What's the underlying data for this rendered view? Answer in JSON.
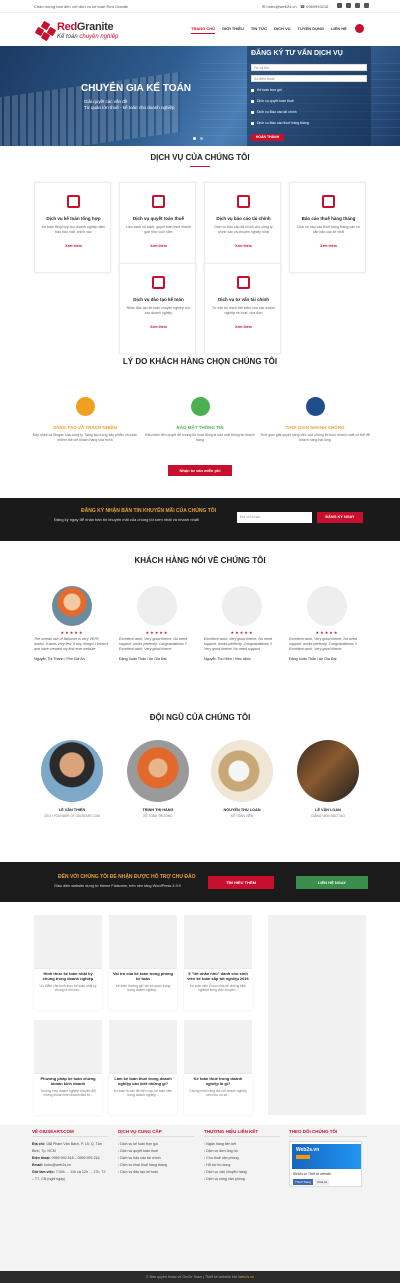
{
  "topbar": {
    "welcome": "Chào mừng bạn đến với dịch vụ kế toán Red Granite",
    "email": "hotro@web2s.vn",
    "phone": "0969993216"
  },
  "logo": {
    "brand_red": "Red",
    "brand_dark": "Granite",
    "sub1": "Kế toán",
    "sub2": "chuyên nghiệp"
  },
  "nav": [
    "Trang chủ",
    "Giới thiệu",
    "Tin tức",
    "Dịch vụ",
    "Tuyển dụng",
    "Liên hệ"
  ],
  "hero": {
    "title": "CHUYÊN GIA KẾ TOÁN",
    "line1": "Giải quyết các vấn đề",
    "line2": "Từ quản lớn thuế - kế toán cho doanh nghiệp",
    "form": {
      "title": "ĐĂNG KÝ TƯ VẤN DỊCH VỤ",
      "name_placeholder": "Họ và tên",
      "phone_placeholder": "Số điện thoại",
      "options": [
        "Kế toán trọn gói",
        "Dịch vụ quyết toán thuế",
        "Dịch vụ Báo cáo tài chính",
        "Dịch vụ Báo cáo thuế hàng tháng"
      ],
      "submit": "HOÀN THÀNH"
    }
  },
  "services": {
    "title": "DỊCH VỤ CỦA CHÚNG TÔI",
    "more": "Xem thêm",
    "items": [
      {
        "title": "Dịch vụ kế toán tổng hợp",
        "desc": "Kế toán tổng hợp cho doanh nghiệp đảm bảo báo mất, chính xác"
      },
      {
        "title": "Dịch vụ quyết toán thuế",
        "desc": "Làm sạch số sách, quyết toán thuế nhanh gọn như cuối năm"
      },
      {
        "title": "Dịch vụ báo cáo tài chính",
        "desc": "Dịch vụ báo cáo tài chính cho công ty chính xác và chuyên nghiệp nhất"
      },
      {
        "title": "Báo cáo thuế hàng tháng",
        "desc": "Dịch vụ báo cáo thuế hàng tháng cần có sẵn bảo các kê nhất"
      },
      {
        "title": "Dịch vụ đào tạo kế toán",
        "desc": "Nhận đào tạo kế toán chuyên nghiệp cho các doanh nghiệp"
      },
      {
        "title": "Dịch vụ tư vấn tài chính",
        "desc": "Tư vấn tài chính tiết kiệm cho các doanh nghiệp về thuế, hóa đơn"
      }
    ]
  },
  "reasons": {
    "title": "LÝ DO KHÁCH HÀNG CHỌN CHÚNG TÔI",
    "items": [
      {
        "title": "SÁNG TẠO VÀ TRÁCH NHIỆM",
        "desc": "Đây chính là Slogan của công ty. Sáng tạo trong sản phẩm và trách nhiệm đối với khách hàng của mình"
      },
      {
        "title": "BẢO MẬT THÔNG TIN",
        "desc": "Điều kiện tiên quyết để chúng tôi hoạt động là bảo mật thông tin khách hàng"
      },
      {
        "title": "THỜI GIAN NHANH CHÓNG",
        "desc": "Thời gian giải quyết công việc của chúng tôi luôn nhanh nhất có thể để khách hàng hài lòng"
      }
    ],
    "button": "Nhận tư vấn miễn phí"
  },
  "newsletter": {
    "title": "ĐĂNG KÝ NHẬN BẢN TIN KHUYẾN MÃI CỦA CHÚNG TÔI",
    "desc": "Đăng ký ngay để nhận bản tin khuyến mãi của chúng tôi sớm nhất và nhanh nhất!",
    "placeholder": "Địa chỉ email",
    "button": "ĐĂNG KÝ NGAY"
  },
  "testimonials": {
    "title": "KHÁCH HÀNG NÓI VỀ CHÚNG TÔI",
    "stars": "★★★★★",
    "items": [
      {
        "quote": "The overall use of flatsome is very VERY useful. It lacks very few, if any, things! I loved it and have created my first ever website",
        "name": "Nguyễn Thị Thanh",
        "role": "Phó Gia An"
      },
      {
        "quote": "Excellent work, Very good theme, No need support, works perfectly. Congratulations !! Excellent work, Very good theme",
        "name": "Đặng Xuân Thăn",
        "role": "An Gia Đạt"
      },
      {
        "quote": "Excellent work, Very good theme, No need support, works perfectly. Congratulations !! Very good theme! No need support",
        "name": "Nguyễn Thu Hiền",
        "role": "Vinc clinic"
      },
      {
        "quote": "Excellent work, Very good theme, No need support, works perfectly. Congratulations !! Excellent work, Very good theme",
        "name": "Đặng Xuân Thăn",
        "role": "An Gia Đạt"
      }
    ]
  },
  "team": {
    "title": "ĐỘI NGŨ CỦA CHÚNG TÔI",
    "items": [
      {
        "name": "LÊ VĂN THIỆN",
        "role": "CEO / FOUNDER OF GIUSEART.COM"
      },
      {
        "name": "TRỊNH THỊ HẰNG",
        "role": "KẾ TOÁN TRƯỞNG"
      },
      {
        "name": "NGUYỄN THU LOAN",
        "role": "KẾ TOÁN VIÊN"
      },
      {
        "name": "LÊ VĂN LOAN",
        "role": "GIẢNG VIÊN ĐÀO TẠO"
      }
    ]
  },
  "promo": {
    "title": "ĐẾN VỚI CHÚNG TÔI ĐỂ NHẬN ĐƯỢC HỖ TRỢ CHU ĐÁO",
    "desc": "Giao diện website dựng từ theme Flatsome, trên nền tảng WordPress 4.9.9",
    "more": "TÌM HIỂU THÊM",
    "contact": "LIÊN HỆ NGAY"
  },
  "posts": [
    {
      "title": "Hình thức kế toán nhật ký chung trong doanh nghiệp",
      "desc": "Ưu điểm của hình thức kế toán nhật ký chung là với các..."
    },
    {
      "title": "Vai trò của kế toán trong phòng kế toán",
      "desc": "Kế toán trưởng giữ vai trò quan trọng trong doanh nghiệp..."
    },
    {
      "title": "5 \"lời nhắn nhủ\" dành cho sinh viên kế toán sắp tốt nghiệp 2016",
      "desc": "Kế toán viên Zoom chia sẻ những kinh nghiệm công việc chuyên..."
    },
    {
      "title": "Phương pháp kế toán chứng khoán kinh doanh",
      "desc": "Trường hợp doanh nghiệp chuyển đổi chứng khoán kinh doanh đầu tư..."
    },
    {
      "title": "Làm kế toán thuế trong doanh nghiệp cần biết những gì?",
      "desc": "Kế toán là vấn đề hiện nay, kế toán viên trong doanh nghiệp..."
    },
    {
      "title": "Kế toán thuế trong doanh nghiệp là gì?",
      "desc": "Chứng minh rằng đối với doanh nghiệp nếu như có sẽ..."
    }
  ],
  "footer": {
    "col1": {
      "title": "VỀ GIUSEART.COM",
      "address_label": "Địa chỉ:",
      "address": "188 Phạm Văn Bạch, P. 15, Q. Tân Bình, Tp. HCM",
      "phone_label": "Điện thoại:",
      "phone": "0969.992.518 – 0969.993.216",
      "email_label": "Email:",
      "email": "hotro@web2s.vn",
      "hours_label": "Giờ làm việc:",
      "hours": "7:30h → 11h và 12h → 17h, T2 – T7, CN (nghỉ ngày)"
    },
    "col2": {
      "title": "DỊCH VỤ CUNG CẤP",
      "items": [
        "Dịch vụ kế toán trọn gói",
        "Dịch vụ quyết toán thuế",
        "Dịch vụ báo cáo tài chính",
        "Dịch vụ khai thuế hàng tháng",
        "Dịch vụ đào tạo kế toán"
      ]
    },
    "col3": {
      "title": "THƯƠNG HIỆU LIÊN KẾT",
      "items": [
        "Ngân hàng liên kết",
        "Dịch vụ đơn ủng hộ",
        "Cho thuê văn phòng",
        "Hỗ trợ tín dụng",
        "Dịch vụ vận chuyển hàng",
        "Dịch vụ công văn phòng"
      ]
    },
    "col4": {
      "title": "THEO DÕI CHÚNG TÔI",
      "fb_name": "Web2s.vn",
      "fb_label": "Web2s.vn Thiết kế website",
      "like": "Thích Trang",
      "share": "Chia sẻ"
    }
  },
  "copyright": {
    "text": "© Bản quyền thuộc về GiuSe Team | Thiết kế website bởi",
    "brand": "Web2s.vn"
  }
}
